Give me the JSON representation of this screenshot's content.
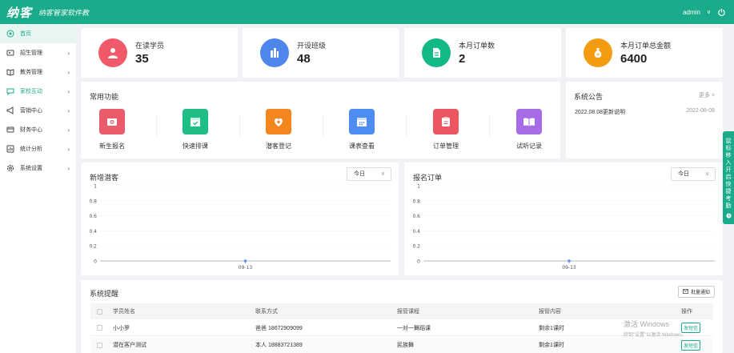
{
  "header": {
    "logo": "纳客",
    "slogan": "纳客管家软件教",
    "user": "admin",
    "user_dropdown": "∨"
  },
  "sidebar": {
    "items": [
      {
        "label": "首页",
        "icon": "home-icon"
      },
      {
        "label": "招生管理",
        "icon": "id-card-icon"
      },
      {
        "label": "教务管理",
        "icon": "book-icon"
      },
      {
        "label": "家校互动",
        "icon": "chat-icon"
      },
      {
        "label": "营销中心",
        "icon": "megaphone-icon"
      },
      {
        "label": "财务中心",
        "icon": "wallet-icon"
      },
      {
        "label": "统计分析",
        "icon": "chart-icon"
      },
      {
        "label": "系统设置",
        "icon": "gear-icon"
      }
    ],
    "arrow": "›"
  },
  "stats": [
    {
      "label": "在读学员",
      "value": "35",
      "color": "#f0596a"
    },
    {
      "label": "开设班级",
      "value": "48",
      "color": "#4f86ec"
    },
    {
      "label": "本月订单数",
      "value": "2",
      "color": "#12b886"
    },
    {
      "label": "本月订单总金额",
      "value": "6400",
      "color": "#f39c12"
    }
  ],
  "quick": {
    "title": "常用功能",
    "items": [
      {
        "label": "新生报名",
        "color": "#e95b6b"
      },
      {
        "label": "快速排课",
        "color": "#1dbd84"
      },
      {
        "label": "潜客登记",
        "color": "#f3861d"
      },
      {
        "label": "课表查看",
        "color": "#4d8cf0"
      },
      {
        "label": "订单管理",
        "color": "#ec5662"
      },
      {
        "label": "试听记录",
        "color": "#a66ce8"
      }
    ]
  },
  "notice": {
    "title": "系统公告",
    "more": "更多 >",
    "item_title": "2022.08.08更新说明",
    "item_date": "2022-08-08"
  },
  "charts_ui": {
    "left_title": "新增潜客",
    "right_title": "报名订单",
    "period_left": "今日",
    "period_right": "今日",
    "dropdown": "∨"
  },
  "chart_data": [
    {
      "type": "line",
      "title": "新增潜客",
      "x": [
        "09-13"
      ],
      "y_ticks": [
        "1",
        "0.8",
        "0.6",
        "0.4",
        "0.2",
        "0"
      ],
      "series": [
        {
          "values": [
            0
          ]
        }
      ],
      "ylim": [
        0,
        1
      ],
      "grid": true
    },
    {
      "type": "line",
      "title": "报名订单",
      "x": [
        "09-13"
      ],
      "y_ticks": [
        "1",
        "0.8",
        "0.6",
        "0.4",
        "0.2",
        "0"
      ],
      "series": [
        {
          "values": [
            0
          ]
        }
      ],
      "ylim": [
        0,
        1
      ],
      "grid": true
    }
  ],
  "reminder": {
    "title": "系统提醒",
    "batch": "批量通知",
    "columns": [
      "学员姓名",
      "联系方式",
      "报管课程",
      "报管内容",
      "操作"
    ],
    "rows": [
      {
        "name": "小小罗",
        "contact": "爸爸 18672909099",
        "course": "一对一舞蹈课",
        "content": "剩余1课时",
        "action": "发短信"
      },
      {
        "name": "潜在客户测试",
        "contact": "本人 18883721389",
        "course": "民族舞",
        "content": "剩余1课时",
        "action": "发短信"
      }
    ]
  },
  "float_tab": {
    "text": "鼠标移入 开启快捷考勤"
  },
  "watermark": {
    "line1": "激活 Windows",
    "line2": "转到\"设置\"以激活 Windows。"
  },
  "colors": {
    "brand": "#1aab8a"
  }
}
